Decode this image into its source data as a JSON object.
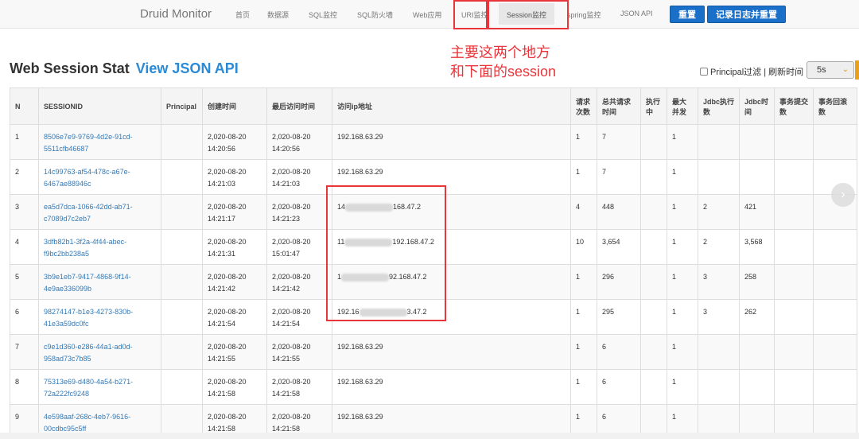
{
  "nav": {
    "brand": "Druid Monitor",
    "items": [
      "首页",
      "数据源",
      "SQL监控",
      "SQL防火墙",
      "Web应用",
      "URI监控",
      "Session监控",
      "spring监控",
      "JSON API"
    ],
    "active_index": 6,
    "reset_label": "重置",
    "log_reset_label": "记录日志并重置"
  },
  "annotation": {
    "line1": "主要这两个地方",
    "line2": "和下面的session"
  },
  "heading": {
    "title": "Web Session Stat",
    "link": "View JSON API"
  },
  "filter": {
    "principal_label": "Principal过滤 | 刷新时间",
    "refresh_value": "5s"
  },
  "table": {
    "columns": [
      "N",
      "SESSIONID",
      "Principal",
      "创建时间",
      "最后访问时间",
      "访问ip地址",
      "请求次数",
      "总共请求时间",
      "执行中",
      "最大并发",
      "Jdbc执行数",
      "Jdbc时间",
      "事务提交数",
      "事务回滚数"
    ],
    "rows": [
      {
        "n": "1",
        "id": "8506e7e9-9769-4d2e-91cd-5511cfb46687",
        "principal": "",
        "create": "2,020-08-20 14:20:56",
        "last": "2,020-08-20 14:20:56",
        "ip": "192.168.63.29",
        "ip_prefix": "",
        "ip_suffix": "",
        "req": "1",
        "reqtime": "7",
        "running": "",
        "concurrent": "1",
        "jdbc_exec": "",
        "jdbc_time": "",
        "commit": "",
        "rollback": ""
      },
      {
        "n": "2",
        "id": "14c99763-af54-478c-a67e-6467ae88946c",
        "principal": "",
        "create": "2,020-08-20 14:21:03",
        "last": "2,020-08-20 14:21:03",
        "ip": "192.168.63.29",
        "ip_prefix": "",
        "ip_suffix": "",
        "req": "1",
        "reqtime": "7",
        "running": "",
        "concurrent": "1",
        "jdbc_exec": "",
        "jdbc_time": "",
        "commit": "",
        "rollback": ""
      },
      {
        "n": "3",
        "id": "ea5d7dca-1066-42dd-ab71-c7089d7c2eb7",
        "principal": "",
        "create": "2,020-08-20 14:21:17",
        "last": "2,020-08-20 14:21:23",
        "ip": "",
        "ip_prefix": "14",
        "ip_suffix": "168.47.2",
        "req": "4",
        "reqtime": "448",
        "running": "",
        "concurrent": "1",
        "jdbc_exec": "2",
        "jdbc_time": "421",
        "commit": "",
        "rollback": ""
      },
      {
        "n": "4",
        "id": "3dfb82b1-3f2a-4f44-abec-f9bc2bb238a5",
        "principal": "",
        "create": "2,020-08-20 14:21:31",
        "last": "2,020-08-20 15:01:47",
        "ip": "",
        "ip_prefix": "11",
        "ip_suffix": "192.168.47.2",
        "req": "10",
        "reqtime": "3,654",
        "running": "",
        "concurrent": "1",
        "jdbc_exec": "2",
        "jdbc_time": "3,568",
        "commit": "",
        "rollback": ""
      },
      {
        "n": "5",
        "id": "3b9e1eb7-9417-4868-9f14-4e9ae336099b",
        "principal": "",
        "create": "2,020-08-20 14:21:42",
        "last": "2,020-08-20 14:21:42",
        "ip": "",
        "ip_prefix": "1",
        "ip_suffix": "92.168.47.2",
        "req": "1",
        "reqtime": "296",
        "running": "",
        "concurrent": "1",
        "jdbc_exec": "3",
        "jdbc_time": "258",
        "commit": "",
        "rollback": ""
      },
      {
        "n": "6",
        "id": "98274147-b1e3-4273-830b-41e3a59dc0fc",
        "principal": "",
        "create": "2,020-08-20 14:21:54",
        "last": "2,020-08-20 14:21:54",
        "ip": "",
        "ip_prefix": "192.16",
        "ip_suffix": "3.47.2",
        "req": "1",
        "reqtime": "295",
        "running": "",
        "concurrent": "1",
        "jdbc_exec": "3",
        "jdbc_time": "262",
        "commit": "",
        "rollback": ""
      },
      {
        "n": "7",
        "id": "c9e1d360-e286-44a1-ad0d-958ad73c7b85",
        "principal": "",
        "create": "2,020-08-20 14:21:55",
        "last": "2,020-08-20 14:21:55",
        "ip": "192.168.63.29",
        "ip_prefix": "",
        "ip_suffix": "",
        "req": "1",
        "reqtime": "6",
        "running": "",
        "concurrent": "1",
        "jdbc_exec": "",
        "jdbc_time": "",
        "commit": "",
        "rollback": ""
      },
      {
        "n": "8",
        "id": "75313e69-d480-4a54-b271-72a222fc9248",
        "principal": "",
        "create": "2,020-08-20 14:21:58",
        "last": "2,020-08-20 14:21:58",
        "ip": "192.168.63.29",
        "ip_prefix": "",
        "ip_suffix": "",
        "req": "1",
        "reqtime": "6",
        "running": "",
        "concurrent": "1",
        "jdbc_exec": "",
        "jdbc_time": "",
        "commit": "",
        "rollback": ""
      },
      {
        "n": "9",
        "id": "4e598aaf-268c-4eb7-9616-00cdbc95c5ff",
        "principal": "",
        "create": "2,020-08-20 14:21:58",
        "last": "2,020-08-20 14:21:58",
        "ip": "192.168.63.29",
        "ip_prefix": "",
        "ip_suffix": "",
        "req": "1",
        "reqtime": "6",
        "running": "",
        "concurrent": "1",
        "jdbc_exec": "",
        "jdbc_time": "",
        "commit": "",
        "rollback": ""
      }
    ]
  }
}
